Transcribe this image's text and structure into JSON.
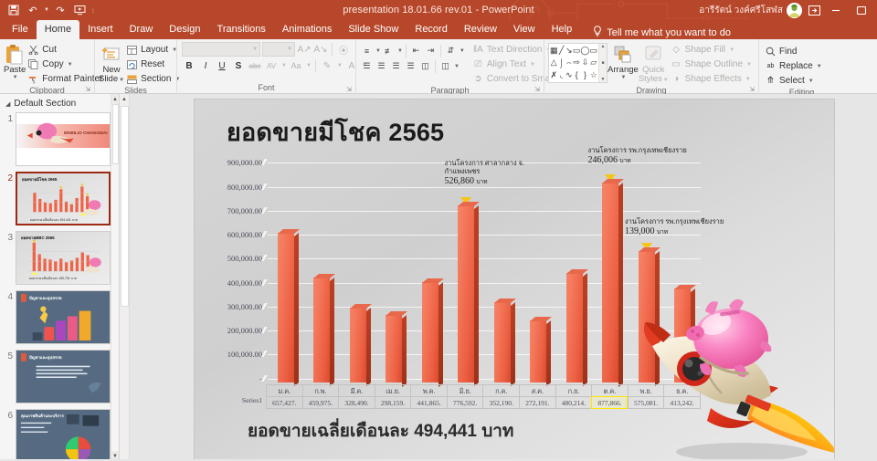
{
  "titlebar": {
    "document_title": "presentation 18.01.66 rev.01  -  PowerPoint",
    "account_name": "อารีรัตน์ วงค์ศรีโสฬส",
    "qat": [
      {
        "name": "save",
        "glyph": "💾"
      },
      {
        "name": "undo",
        "glyph": "↶"
      },
      {
        "name": "redo",
        "glyph": "↻"
      },
      {
        "name": "start-slideshow",
        "glyph": "▷"
      }
    ],
    "ribbon_display_options": "⬒",
    "minimize": "—",
    "restore": "⬜",
    "close": "✕"
  },
  "tabs": [
    {
      "label": "File",
      "active": false
    },
    {
      "label": "Home",
      "active": true
    },
    {
      "label": "Insert",
      "active": false
    },
    {
      "label": "Draw",
      "active": false
    },
    {
      "label": "Design",
      "active": false
    },
    {
      "label": "Transitions",
      "active": false
    },
    {
      "label": "Animations",
      "active": false
    },
    {
      "label": "Slide Show",
      "active": false
    },
    {
      "label": "Record",
      "active": false
    },
    {
      "label": "Review",
      "active": false
    },
    {
      "label": "View",
      "active": false
    },
    {
      "label": "Help",
      "active": false
    }
  ],
  "tellme": {
    "placeholder": "Tell me what you want to do",
    "icon": "💡"
  },
  "ribbon": {
    "clipboard": {
      "label": "Clipboard",
      "paste": "Paste",
      "items": [
        {
          "label": "Cut",
          "icon": "✂"
        },
        {
          "label": "Copy",
          "icon": "⧉"
        },
        {
          "label": "Format Painter",
          "icon": "🖌"
        }
      ]
    },
    "slides": {
      "label": "Slides",
      "new_slide": "New\nSlide",
      "new_slide_l1": "New",
      "new_slide_l2": "Slide",
      "items": [
        {
          "label": "Layout",
          "icon": "▤"
        },
        {
          "label": "Reset",
          "icon": "↺"
        },
        {
          "label": "Section",
          "icon": "▧"
        }
      ]
    },
    "font": {
      "label": "Font",
      "font_name": "",
      "font_size": "",
      "buttons": [
        "A↑",
        "A↓",
        "⌫",
        "B",
        "I",
        "U",
        "S",
        "abc",
        "AV",
        "Aa",
        "✎",
        "A"
      ]
    },
    "paragraph": {
      "label": "Paragraph",
      "items": [
        {
          "label": "Text Direction",
          "icon": "‖A"
        },
        {
          "label": "Align Text",
          "icon": "⬚"
        },
        {
          "label": "Convert to SmartArt",
          "icon": "➤"
        }
      ]
    },
    "drawing": {
      "label": "Drawing",
      "shapes": [
        "▣",
        "╲",
        "↘",
        "▭",
        "◯",
        "▭",
        "△",
        "⌐",
        "⌙",
        "⇨",
        "⇩",
        "◱",
        "✇",
        "◜",
        "∿",
        "{",
        "}",
        "☆"
      ],
      "arrange": "Arrange",
      "quick_styles_l1": "Quick",
      "quick_styles_l2": "Styles",
      "items": [
        {
          "label": "Shape Fill",
          "icon": "◇"
        },
        {
          "label": "Shape Outline",
          "icon": "▭"
        },
        {
          "label": "Shape Effects",
          "icon": "◑"
        }
      ]
    },
    "editing": {
      "label": "Editing",
      "items": [
        {
          "label": "Find",
          "icon": "🔍"
        },
        {
          "label": "Replace",
          "icon": "ab"
        },
        {
          "label": "Select",
          "icon": "↖"
        }
      ]
    }
  },
  "slide_panel": {
    "section_name": "Default Section",
    "slides": [
      {
        "number": "1",
        "selected": false,
        "kind": "title",
        "title": "MOBILIO CHIANGMAI"
      },
      {
        "number": "2",
        "selected": true,
        "kind": "chart",
        "title": "ยอดขายมีโชค 2565",
        "caption": "ยอดขายเฉลี่ยเดือนละ 494,441 บาท"
      },
      {
        "number": "3",
        "selected": false,
        "kind": "chart",
        "title": "ยอดขายBBC 2565",
        "caption": "ยอดขายเฉลี่ยเดือนละ 180,751 บาท"
      },
      {
        "number": "4",
        "selected": false,
        "kind": "steps",
        "title": "ปัญหาและอุปสรรค"
      },
      {
        "number": "5",
        "selected": false,
        "kind": "text",
        "title": "ปัญหาและอุปสรรค"
      },
      {
        "number": "6",
        "selected": false,
        "kind": "pie",
        "title": "คุณภาพสินค้าและบริการ"
      }
    ]
  },
  "slide": {
    "title": "ยอดขายมีโชค 2565",
    "footer_caption": "ยอดขายเฉลี่ยเดือนละ  494,441 บาท",
    "series_label": "Series1",
    "image_alt": "piggy-bank-rocket"
  },
  "chart_data": {
    "type": "bar",
    "title": "ยอดขายมีโชค 2565",
    "xlabel": "",
    "ylabel": "",
    "ylim": [
      0,
      900000
    ],
    "ytick_labels": [
      "900,000.00",
      "800,000.00",
      "700,000.00",
      "600,000.00",
      "500,000.00",
      "400,000.00",
      "300,000.00",
      "200,000.00",
      "100,000.00",
      "-"
    ],
    "ytick_values": [
      900000,
      800000,
      700000,
      600000,
      500000,
      400000,
      300000,
      200000,
      100000,
      0
    ],
    "grid": true,
    "legend": false,
    "series_name": "Series1",
    "categories": [
      "ม.ค.",
      "ก.พ.",
      "มี.ค.",
      "เม.ย.",
      "พ.ค.",
      "มิ.ย.",
      "ก.ค.",
      "ส.ค.",
      "ก.ย.",
      "ต.ค.",
      "พ.ย.",
      "ธ.ค."
    ],
    "values": [
      657427,
      459975,
      328490,
      298159,
      441865,
      776592,
      352190,
      272191,
      480214,
      877866,
      575081,
      413242
    ],
    "value_labels": [
      "657,427.",
      "459,975.",
      "328,490.",
      "298,159.",
      "441,865.",
      "776,592.",
      "352,190.",
      "272,191.",
      "480,214.",
      "877,866.",
      "575,081.",
      "413,242."
    ],
    "highlighted_cell_index": 9,
    "annotations": [
      {
        "index": 5,
        "line1": "งานโครงการ ศาลากลาง จ.",
        "line2": "กำแพงเพชร",
        "amount": "526,860",
        "unit": "บาท"
      },
      {
        "index": 9,
        "line1": "งานโครงการ รพ.กรุงเทพเชียงราย",
        "line2": "",
        "amount": "246,006",
        "unit": "บาท"
      },
      {
        "index": 10,
        "line1": "งานโครงการ รพ.กรุงเทพเชียงราย",
        "line2": "",
        "amount": "139,000",
        "unit": "บาท"
      }
    ],
    "average_label": "ยอดขายเฉลี่ยเดือนละ  494,441 บาท",
    "bar_color": "#ef6347",
    "marker_color": "#f5c518"
  }
}
